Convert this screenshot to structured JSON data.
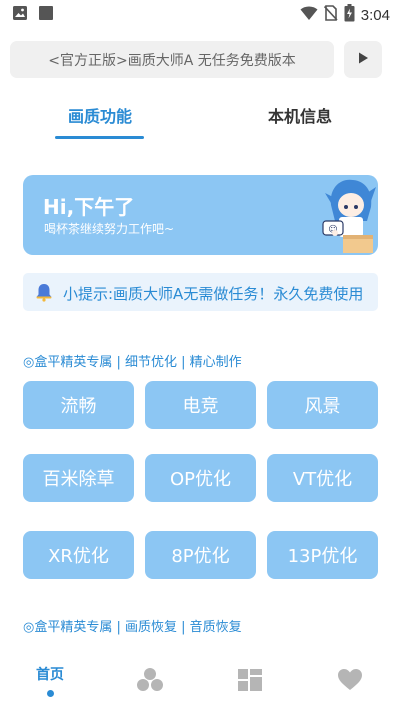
{
  "status_bar": {
    "time": "3:04",
    "icons": [
      "image-icon",
      "stop-square-icon",
      "wifi-icon",
      "no-sim-icon",
      "battery-charging-icon"
    ]
  },
  "browser": {
    "url_text": "<官方正版>画质大师A 无任务免费版本",
    "play_icon": "play-icon"
  },
  "tabs": [
    {
      "label": "画质功能",
      "active": true
    },
    {
      "label": "本机信息",
      "active": false
    }
  ],
  "banner": {
    "title": "Hi,下午了",
    "subtitle": "喝杯茶继续努力工作吧~"
  },
  "notice": {
    "icon": "bell-icon",
    "text": "小提示:画质大师A无需做任务！永久免费使用"
  },
  "sections": [
    {
      "title": "◎盒平精英专属 | 细节优化 | 精心制作"
    },
    {
      "title": "◎盒平精英专属 | 画质恢复 | 音质恢复"
    }
  ],
  "buttons": [
    {
      "label": "流畅"
    },
    {
      "label": "电竞"
    },
    {
      "label": "风景"
    },
    {
      "label": "百米除草"
    },
    {
      "label": "OP优化"
    },
    {
      "label": "VT优化"
    },
    {
      "label": "XR优化"
    },
    {
      "label": "8P优化"
    },
    {
      "label": "13P优化"
    }
  ],
  "bottom_nav": [
    {
      "label": "首页",
      "icon": "home",
      "active": true
    },
    {
      "label": "",
      "icon": "three-circles-icon",
      "active": false
    },
    {
      "label": "",
      "icon": "dashboard-icon",
      "active": false
    },
    {
      "label": "",
      "icon": "heart-icon",
      "active": false
    }
  ],
  "colors": {
    "accent": "#2a8bd4",
    "button_bg": "#8cc6f3",
    "notice_bg": "#eaf3fc",
    "inactive_icon": "#b5b5b5"
  }
}
